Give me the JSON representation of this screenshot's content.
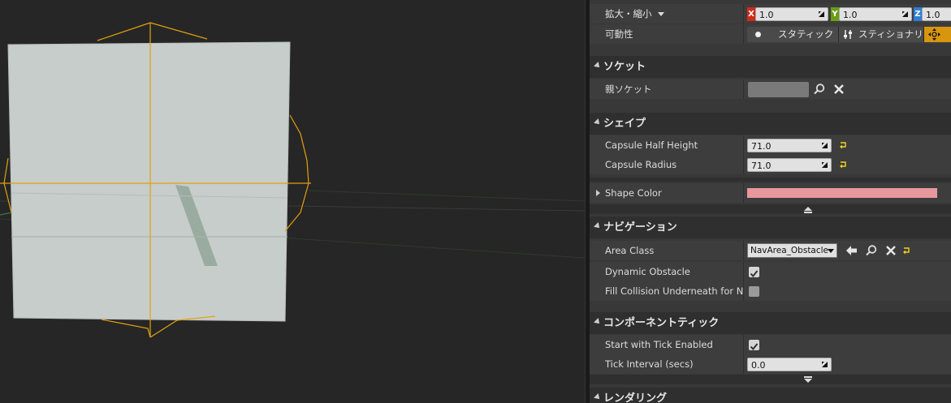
{
  "colors": {
    "viewport_bg": "#262626",
    "capsule_fill": "#c7cdcb",
    "wireframe": "#e3a10e",
    "axis_x": "#cf2a1a",
    "axis_y": "#6a9e16",
    "axis_z": "#2f7ed6",
    "mobility_selected": "#d8960f",
    "shape_color": "#e8979f"
  },
  "transform": {
    "scale_label": "拡大・縮小",
    "scale_x": "1.0",
    "scale_y": "1.0",
    "scale_z": "1.0",
    "axis_x": "X",
    "axis_y": "Y",
    "axis_z": "Z",
    "mobility_label": "可動性",
    "mobility_static": "スタティック",
    "mobility_stationary": "スティショナリー"
  },
  "socket": {
    "title": "ソケット",
    "parent_label": "親ソケット",
    "parent_value": ""
  },
  "shape": {
    "title": "シェイプ",
    "half_height_label": "Capsule Half Height",
    "half_height_value": "71.0",
    "radius_label": "Capsule Radius",
    "radius_value": "71.0",
    "color_label": "Shape Color"
  },
  "navigation": {
    "title": "ナビゲーション",
    "area_class_label": "Area Class",
    "area_class_value": "NavArea_Obstacle",
    "dynamic_obstacle_label": "Dynamic Obstacle",
    "dynamic_obstacle_checked": true,
    "fill_collision_label": "Fill Collision Underneath for Navm",
    "fill_collision_checked": false
  },
  "tick": {
    "title": "コンポーネントティック",
    "start_enabled_label": "Start with Tick Enabled",
    "start_enabled_checked": true,
    "interval_label": "Tick Interval (secs)",
    "interval_value": "0.0"
  },
  "rendering": {
    "title": "レンダリング"
  },
  "icons": {
    "browse": "search-icon",
    "clear": "close-icon",
    "use_selected": "arrow-left-icon",
    "reset": "reset-arrow-icon",
    "drag": "drag-handle-icon"
  }
}
